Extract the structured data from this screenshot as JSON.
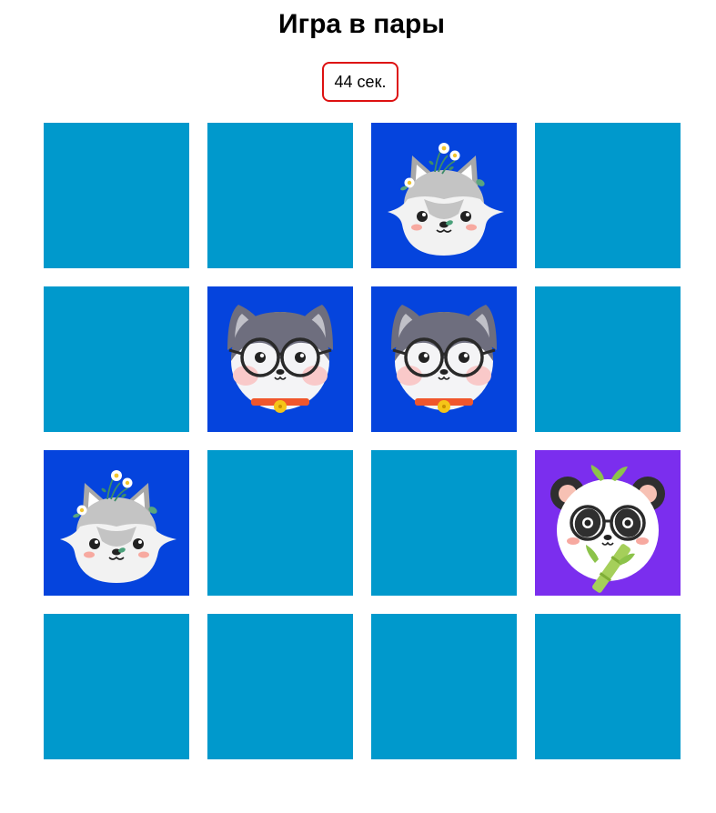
{
  "title": "Игра в пары",
  "timer": {
    "text": "44 сек."
  },
  "colors": {
    "card_back": "#0099cc",
    "card_face_blue": "#0544dd",
    "card_face_purple": "#7b2eee",
    "timer_border": "#dd1111"
  },
  "cards": [
    {
      "state": "hidden"
    },
    {
      "state": "hidden"
    },
    {
      "state": "revealed",
      "image": "wolf-with-flowers-icon",
      "bg": "#0544dd"
    },
    {
      "state": "hidden"
    },
    {
      "state": "hidden"
    },
    {
      "state": "revealed",
      "image": "husky-with-glasses-icon",
      "bg": "#0544dd"
    },
    {
      "state": "revealed",
      "image": "husky-with-glasses-icon",
      "bg": "#0544dd"
    },
    {
      "state": "hidden"
    },
    {
      "state": "revealed",
      "image": "wolf-with-flowers-icon",
      "bg": "#0544dd"
    },
    {
      "state": "hidden"
    },
    {
      "state": "hidden"
    },
    {
      "state": "revealed",
      "image": "panda-with-glasses-icon",
      "bg": "#7b2eee"
    },
    {
      "state": "hidden"
    },
    {
      "state": "hidden"
    },
    {
      "state": "hidden"
    },
    {
      "state": "hidden"
    }
  ]
}
